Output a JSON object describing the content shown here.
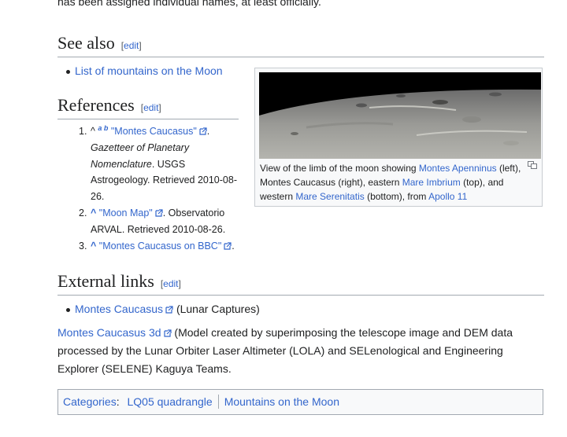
{
  "top_fragment": "has been assigned individual names, at least officially.",
  "see_also": {
    "heading": "See also",
    "edit": "edit",
    "items": [
      "List of mountains on the Moon"
    ]
  },
  "references": {
    "heading": "References",
    "edit": "edit",
    "items": [
      {
        "num": "1.",
        "caret": "^",
        "backlinks": "a b",
        "title": "\"Montes Caucasus\"",
        "rest_italic": "Gazetteer of Planetary Nomenclature",
        "rest": ". USGS Astrogeology. Retrieved 2010-08-26."
      },
      {
        "num": "2.",
        "caret": "^",
        "title": "\"Moon Map\"",
        "rest": ". Observatorio ARVAL. Retrieved 2010-08-26."
      },
      {
        "num": "3.",
        "caret": "^",
        "title": "\"Montes Caucasus on BBC\"",
        "rest": "."
      }
    ]
  },
  "thumb": {
    "caption_parts": [
      {
        "t": "View of the limb of the moon showing ",
        "link": false
      },
      {
        "t": "Montes Apenninus",
        "link": true
      },
      {
        "t": " (left), Montes Caucasus (right), eastern ",
        "link": false
      },
      {
        "t": "Mare Imbrium",
        "link": true
      },
      {
        "t": " (top), and western ",
        "link": false
      },
      {
        "t": "Mare Serenitatis",
        "link": true
      },
      {
        "t": " (bottom), from ",
        "link": false
      },
      {
        "t": "Apollo 11",
        "link": true
      }
    ]
  },
  "external_links": {
    "heading": "External links",
    "edit": "edit",
    "items": [
      {
        "link": "Montes Caucasus",
        "rest": " (Lunar Captures)"
      }
    ],
    "para_link": "Montes Caucasus 3d",
    "para_rest": " (Model created by superimposing the telescope image and DEM data processed by the Lunar Orbiter Laser Altimeter (LOLA) and SELenological and Engineering Explorer (SELENE) Kaguya Teams."
  },
  "categories": {
    "label": "Categories",
    "items": [
      "LQ05 quadrangle",
      "Mountains on the Moon"
    ]
  },
  "colors": {
    "link": "#3366cc",
    "text": "#202122",
    "rule": "#a2a9b1"
  }
}
